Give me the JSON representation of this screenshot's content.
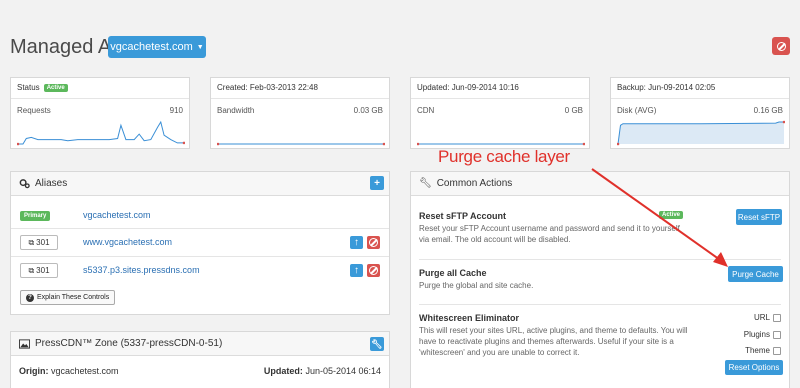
{
  "header": {
    "title": "Managed App:",
    "app_name": "vgcachetest.com"
  },
  "stats": [
    {
      "label": "Status",
      "badge": "Active",
      "metric": "Requests",
      "value": "910"
    },
    {
      "label": "Created: Feb-03-2013 22:48",
      "metric": "Bandwidth",
      "value": "0.03 GB"
    },
    {
      "label": "Updated: Jun-09-2014 10:16",
      "metric": "CDN",
      "value": "0 GB"
    },
    {
      "label": "Backup: Jun-09-2014 02:05",
      "metric": "Disk (AVG)",
      "value": "0.16 GB"
    }
  ],
  "aliases": {
    "title": "Aliases",
    "add_label": "+",
    "rows": [
      {
        "badge": "Primary",
        "domain": "vgcachetest.com"
      },
      {
        "code": "301",
        "domain": "www.vgcachetest.com"
      },
      {
        "code": "301",
        "domain": "s5337.p3.sites.pressdns.com"
      }
    ],
    "explain_label": "Explain These Controls"
  },
  "cdn": {
    "title": "PressCDN™ Zone (5337-pressCDN-0-51)",
    "origin_label": "Origin:",
    "origin_value": "vgcachetest.com",
    "updated_label": "Updated:",
    "updated_value": "Jun-05-2014 06:14"
  },
  "actions": {
    "title": "Common Actions",
    "items": [
      {
        "title": "Reset sFTP Account",
        "badge": "Active",
        "desc": "Reset your sFTP Account username and password and send it to yourself via email. The old account will be disabled.",
        "button": "Reset sFTP"
      },
      {
        "title": "Purge all Cache",
        "desc": "Purge the global and site cache.",
        "button": "Purge Cache"
      },
      {
        "title": "Whitescreen Eliminator",
        "desc": "This will reset your sites URL, active plugins, and theme to defaults. You will have to reactivate plugins and themes afterwards. Useful if your site is a 'whitescreen' and you are unable to correct it.",
        "button": "Reset Options",
        "options": [
          "URL",
          "Plugins",
          "Theme"
        ]
      }
    ]
  },
  "annotation": "Purge cache layer",
  "colors": {
    "accent": "#3a9ad9",
    "danger": "#d9534f",
    "success": "#5cb85c",
    "annotation": "#e0312b"
  },
  "sparklines": [
    [
      0,
      0,
      3,
      0,
      5,
      0.25,
      8,
      0.3,
      12,
      0.2,
      15,
      0.2,
      20,
      0.2,
      26,
      0.2,
      30,
      0.15,
      36,
      0.2,
      44,
      0.2,
      55,
      0.2,
      60,
      0.25,
      62,
      0.85,
      65,
      0.2,
      70,
      0.2,
      73,
      0.45,
      76,
      0.15,
      80,
      0.2,
      84,
      0.75,
      86,
      1,
      88,
      0.4,
      92,
      0.2,
      96,
      0.05,
      100,
      0.05
    ],
    [
      0,
      0,
      50,
      0,
      100,
      0
    ],
    [
      0,
      0,
      50,
      0,
      100,
      0
    ],
    [
      0,
      0,
      1.5,
      0.85,
      3,
      0.92,
      50,
      0.92,
      95,
      0.95,
      97,
      1,
      100,
      1
    ]
  ]
}
